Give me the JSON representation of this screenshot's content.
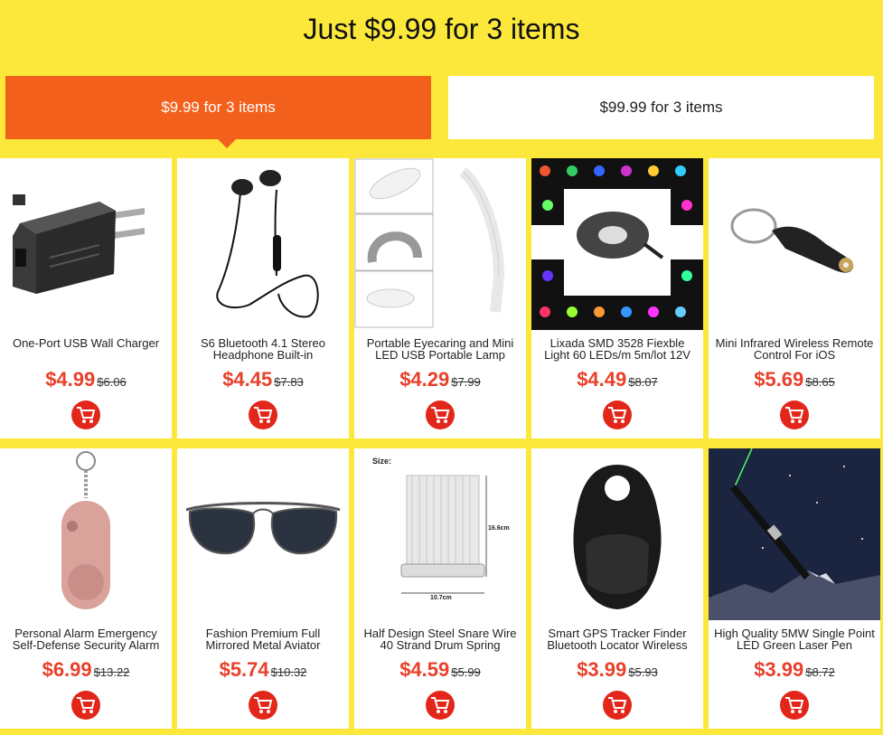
{
  "banner": {
    "title": "Just $9.99 for 3 items"
  },
  "tabs": [
    {
      "label": "$9.99 for 3 items",
      "active": true
    },
    {
      "label": "$99.99 for 3 items",
      "active": false
    }
  ],
  "colors": {
    "background": "#fbe83a",
    "active_tab": "#f2601c",
    "price": "#e8402a",
    "cart": "#e3261a"
  },
  "products": [
    {
      "name": "One-Port USB Wall Charger",
      "price": "$4.99",
      "old_price": "$6.06",
      "icon": "usb-charger-image"
    },
    {
      "name": "S6 Bluetooth 4.1 Stereo Headphone Built-in",
      "price": "$4.45",
      "old_price": "$7.83",
      "icon": "headphone-image"
    },
    {
      "name": "Portable Eyecaring and Mini LED USB Portable Lamp",
      "price": "$4.29",
      "old_price": "$7.99",
      "icon": "usb-lamp-image"
    },
    {
      "name": "Lixada SMD 3528 Fiexble Light 60 LEDs/m 5m/lot 12V",
      "price": "$4.49",
      "old_price": "$8.07",
      "icon": "led-strip-image"
    },
    {
      "name": "Mini Infrared Wireless Remote Control For iOS",
      "price": "$5.69",
      "old_price": "$8.65",
      "icon": "remote-keychain-image"
    },
    {
      "name": "Personal Alarm Emergency Self-Defense Security Alarm",
      "price": "$6.99",
      "old_price": "$13.22",
      "icon": "personal-alarm-image"
    },
    {
      "name": "Fashion Premium Full Mirrored Metal Aviator",
      "price": "$5.74",
      "old_price": "$10.32",
      "icon": "sunglasses-image"
    },
    {
      "name": "Half Design Steel Snare Wire 40 Strand Drum Spring",
      "price": "$4.59",
      "old_price": "$5.99",
      "icon": "snare-wire-image",
      "image_text": {
        "size": "Size:",
        "height": "16.6cm",
        "width": "10.7cm"
      }
    },
    {
      "name": "Smart GPS Tracker Finder Bluetooth Locator Wireless",
      "price": "$3.99",
      "old_price": "$5.93",
      "icon": "gps-tracker-image"
    },
    {
      "name": "High Quality 5MW Single Point LED Green Laser Pen",
      "price": "$3.99",
      "old_price": "$8.72",
      "icon": "laser-pen-image"
    }
  ],
  "cart_icon": "shopping-cart-icon"
}
